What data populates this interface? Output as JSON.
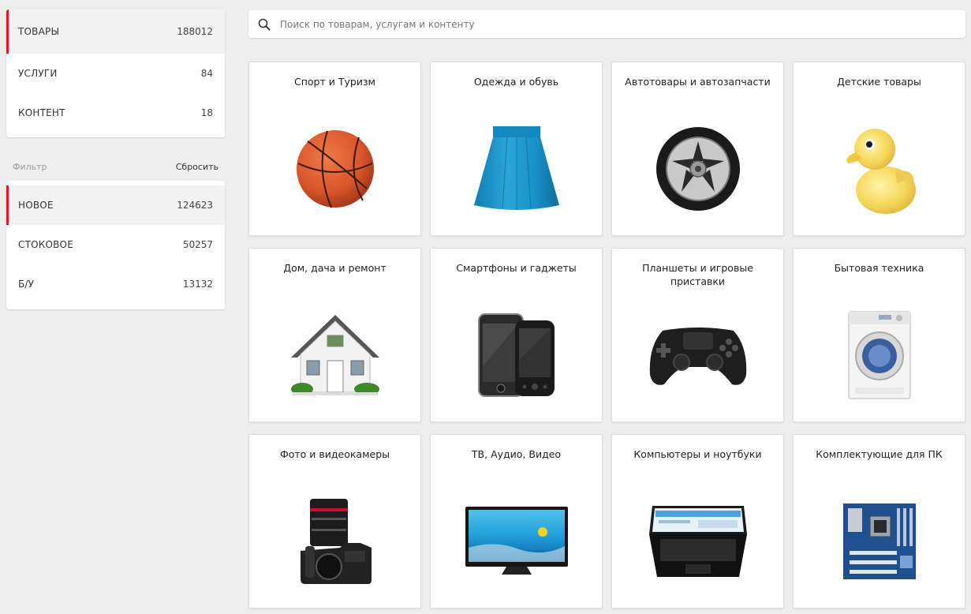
{
  "sidebar": {
    "types": [
      {
        "label": "ТОВАРЫ",
        "count": "188012",
        "active": true
      },
      {
        "label": "УСЛУГИ",
        "count": "84",
        "active": false
      },
      {
        "label": "КОНТЕНТ",
        "count": "18",
        "active": false
      }
    ],
    "filter": {
      "label": "Фильтр",
      "reset": "Сбросить"
    },
    "conditions": [
      {
        "label": "НОВОЕ",
        "count": "124623",
        "active": true
      },
      {
        "label": "СТОКОВОЕ",
        "count": "50257",
        "active": false
      },
      {
        "label": "Б/У",
        "count": "13132",
        "active": false
      }
    ]
  },
  "search": {
    "placeholder": "Поиск по товарам, услугам и контенту",
    "icon": "search-icon"
  },
  "categories": [
    {
      "title": "Спорт и Туризм",
      "icon": "basketball-icon"
    },
    {
      "title": "Одежда и обувь",
      "icon": "skirt-icon"
    },
    {
      "title": "Автотовары и автозапчасти",
      "icon": "wheel-icon"
    },
    {
      "title": "Детские товары",
      "icon": "rubber-duck-icon"
    },
    {
      "title": "Дом, дача и ремонт",
      "icon": "house-icon"
    },
    {
      "title": "Смартфоны и гаджеты",
      "icon": "smartphones-icon"
    },
    {
      "title": "Планшеты и игровые приставки",
      "icon": "gamepad-icon"
    },
    {
      "title": "Бытовая техника",
      "icon": "washing-machine-icon"
    },
    {
      "title": "Фото и видеокамеры",
      "icon": "camera-icon"
    },
    {
      "title": "ТВ, Аудио, Видео",
      "icon": "tv-icon"
    },
    {
      "title": "Компьютеры и ноутбуки",
      "icon": "laptop-icon"
    },
    {
      "title": "Комплектующие для ПК",
      "icon": "motherboard-icon"
    }
  ],
  "colors": {
    "accent": "#d61d23",
    "background": "#eeeeee"
  }
}
